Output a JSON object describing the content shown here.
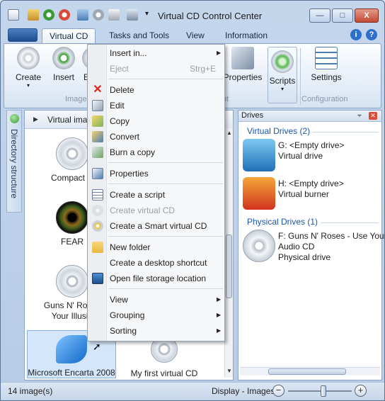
{
  "window": {
    "title": "Virtual CD Control Center",
    "buttons": {
      "minimize": "—",
      "maximize": "□",
      "close": "X"
    },
    "qat_dropdown": "▾"
  },
  "ribbon": {
    "tabs": [
      {
        "label": "Virtual CD"
      },
      {
        "label": "Tasks and Tools"
      },
      {
        "label": "View"
      },
      {
        "label": "Information"
      }
    ],
    "help_icons": [
      "i",
      "?"
    ],
    "buttons": {
      "create": "Create",
      "insert": "Insert",
      "eject_partial": "E",
      "properties": "Properties",
      "scripts": "Scripts",
      "settings": "Settings"
    },
    "groups": {
      "images_partial": "Image",
      "management_partial": "nt",
      "configuration": "Configuration"
    }
  },
  "sidebar": {
    "label": "Directory structure"
  },
  "images_panel": {
    "title": "Virtual ima",
    "items": [
      {
        "label": "Compact D"
      },
      {
        "label": "FEAR"
      },
      {
        "label": "Guns N' Roses\nYour Illusio"
      },
      {
        "label": "Microsoft Encarta 2008"
      },
      {
        "label": "My first virtual CD"
      }
    ]
  },
  "drives_panel": {
    "title": "Drives",
    "pin": "⨪",
    "virtual_section": "Virtual Drives (2)",
    "physical_section": "Physical Drives (1)",
    "virtual_drives": [
      {
        "line1": "G: <Empty drive>",
        "line2": "Virtual drive"
      },
      {
        "line1": "H: <Empty drive>",
        "line2": "Virtual burner"
      }
    ],
    "physical_drives": [
      {
        "line1": "F: Guns N' Roses - Use Your",
        "line2": "Audio CD",
        "line3": "Physical drive"
      }
    ]
  },
  "status_bar": {
    "count": "14 image(s)",
    "display": "Display - Images",
    "zoom_minus": "−",
    "zoom_plus": "+",
    "zoom_level": 0.55
  },
  "context_menu": {
    "items": [
      {
        "label": "Insert in...",
        "submenu": true
      },
      {
        "label": "Eject",
        "shortcut": "Strg+E",
        "disabled": true
      },
      {
        "label": "Delete"
      },
      {
        "label": "Edit"
      },
      {
        "label": "Copy"
      },
      {
        "label": "Convert"
      },
      {
        "label": "Burn a copy"
      },
      {
        "label": "Properties"
      },
      {
        "label": "Create a script"
      },
      {
        "label": "Create virtual CD",
        "disabled": true
      },
      {
        "label": "Create a Smart virtual CD"
      },
      {
        "label": "New folder"
      },
      {
        "label": "Create a desktop shortcut"
      },
      {
        "label": "Open file storage location"
      },
      {
        "label": "View",
        "submenu": true
      },
      {
        "label": "Grouping",
        "submenu": true
      },
      {
        "label": "Sorting",
        "submenu": true
      }
    ],
    "submenu_arrow": "▶"
  },
  "colors": {
    "accent": "#1a56a8",
    "delete_icon": "#e0231b",
    "folder_icon": "#e9b73d",
    "ribbon_border": "#8ca5c6"
  }
}
